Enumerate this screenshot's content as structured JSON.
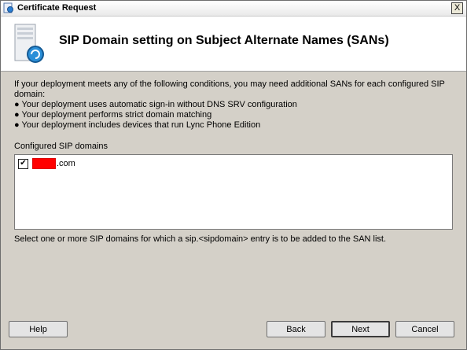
{
  "window": {
    "title": "Certificate Request",
    "close_label": "X"
  },
  "header": {
    "title": "SIP Domain setting on Subject Alternate Names (SANs)"
  },
  "content": {
    "description": "If your deployment meets any of the following conditions, you may need additional SANs for each configured SIP domain:",
    "bullets": [
      "Your deployment uses automatic sign-in without DNS SRV configuration",
      "Your deployment performs strict domain matching",
      "Your deployment includes devices that run Lync Phone Edition"
    ],
    "bullet_glyph": "●",
    "list_label": "Configured SIP domains",
    "domains": [
      {
        "suffix": ".com",
        "checked": true,
        "check_glyph": "✔"
      }
    ],
    "hint": "Select one or more SIP domains for which a sip.<sipdomain> entry is to be added to the SAN list."
  },
  "buttons": {
    "help": "Help",
    "back": "Back",
    "next": "Next",
    "cancel": "Cancel"
  },
  "icons": {
    "title": "certificate-icon",
    "header": "server-certificate-icon"
  }
}
